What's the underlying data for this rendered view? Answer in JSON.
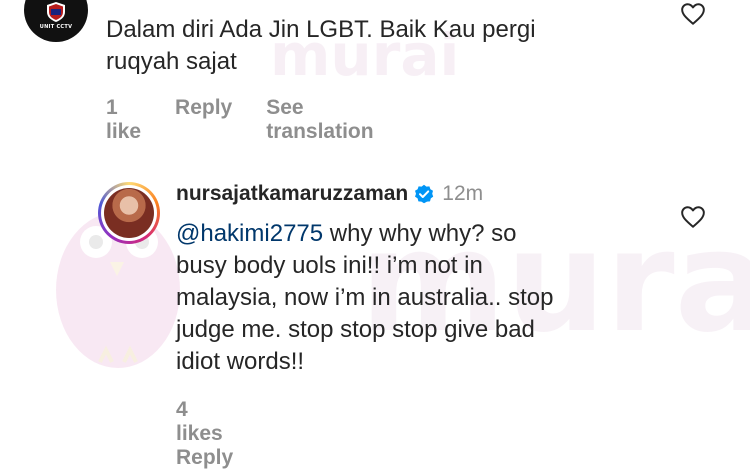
{
  "watermark": {
    "text": "murai"
  },
  "comments": [
    {
      "avatar_label": "UNIT CCTV",
      "text_line1": "Dalam diri Ada Jin LGBT. Baik Kau pergi",
      "text_line2": "ruqyah sajat",
      "likes": "1 like",
      "reply": "Reply",
      "translate": "See translation",
      "like_icon": "heart-outline-icon"
    },
    {
      "username": "nursajatkamaruzzaman",
      "verified_icon": "verified-badge-icon",
      "time": "12m",
      "mention": "@hakimi2775",
      "text_line1": " why why why? so",
      "text_line2": "busy body uols ini!! i’m not in",
      "text_line3": "malaysia, now i’m in australia.. stop",
      "text_line4": "judge me. stop stop stop give bad",
      "text_line5": "idiot words!!",
      "likes": "4 likes",
      "reply": "Reply",
      "like_icon": "heart-outline-icon"
    }
  ],
  "colors": {
    "text": "#262626",
    "secondary": "#8e8e8e",
    "mention": "#00376b",
    "verified": "#0095f6"
  }
}
